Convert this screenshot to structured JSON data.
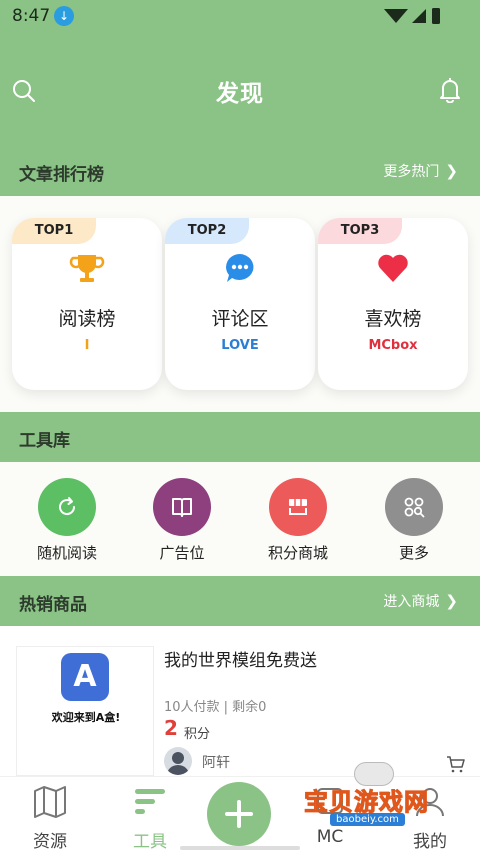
{
  "status_bar": {
    "time": "8:47"
  },
  "header": {
    "title": "发现"
  },
  "article_rank": {
    "section_title": "文章排行榜",
    "more_label": "更多热门",
    "cards": [
      {
        "tag": "TOP1",
        "name": "阅读榜",
        "sub": "I",
        "sub_color": "#f0a318",
        "tag_color": "#fde9c7",
        "icon": "trophy-icon"
      },
      {
        "tag": "TOP2",
        "name": "评论区",
        "sub": "LOVE",
        "sub_color": "#2a7fd4",
        "tag_color": "#d6e8fb",
        "icon": "comment-icon"
      },
      {
        "tag": "TOP3",
        "name": "喜欢榜",
        "sub": "MCbox",
        "sub_color": "#e0303d",
        "tag_color": "#fbd9dc",
        "icon": "heart-icon"
      }
    ]
  },
  "toolbox": {
    "section_title": "工具库",
    "tools": [
      {
        "label": "随机阅读",
        "color": "#5cbf64",
        "icon": "refresh-icon"
      },
      {
        "label": "广告位",
        "color": "#8e3f7e",
        "icon": "book-icon"
      },
      {
        "label": "积分商城",
        "color": "#ec5a5a",
        "icon": "shop-icon"
      },
      {
        "label": "更多",
        "color": "#8f8f8f",
        "icon": "grid-search-icon"
      }
    ]
  },
  "hot_goods": {
    "section_title": "热销商品",
    "more_label": "进入商城",
    "item": {
      "title": "我的世界模组免费送",
      "meta": "10人付款 | 剩余0",
      "price": "2",
      "price_unit": "积分",
      "author": "阿轩",
      "thumb_logo": "A",
      "thumb_welcome": "欢迎来到A盒!"
    }
  },
  "tabbar": {
    "tabs": [
      {
        "label": "资源",
        "icon": "map-icon"
      },
      {
        "label": "工具",
        "icon": "tools-icon"
      },
      {
        "label": "MC",
        "icon": "mc-icon"
      },
      {
        "label": "我的",
        "icon": "user-icon"
      }
    ]
  },
  "watermark": {
    "text": "宝贝游戏网",
    "url": "baobeiy.com"
  },
  "colors": {
    "primary": "#8bc386",
    "price": "#e0403a"
  }
}
